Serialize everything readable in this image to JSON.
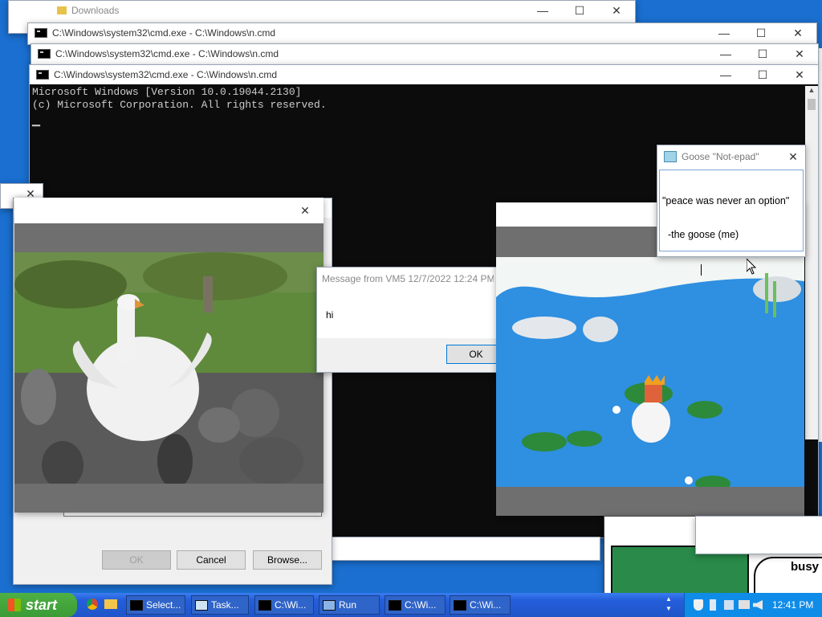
{
  "explorer": {
    "title": "Downloads"
  },
  "cmd": [
    {
      "title": "C:\\Windows\\system32\\cmd.exe - C:\\Windows\\n.cmd"
    },
    {
      "title": "C:\\Windows\\system32\\cmd.exe - C:\\Windows\\n.cmd"
    },
    {
      "title": "C:\\Windows\\system32\\cmd.exe - C:\\Windows\\n.cmd"
    }
  ],
  "console": {
    "line1": "Microsoft Windows [Version 10.0.19044.2130]",
    "line2": "(c) Microsoft Corporation. All rights reserved.",
    "cursor": "▁"
  },
  "notepad": {
    "title": "Goose \"Not-epad\"",
    "line1": "\"peace was never an option\"",
    "line2": "  -the goose (me)"
  },
  "message": {
    "title": "Message from VM5 12/7/2022 12:24 PM",
    "body": "hi",
    "ok": "OK"
  },
  "dialog": {
    "ok": "OK",
    "cancel": "Cancel",
    "browse": "Browse..."
  },
  "busy_text": "busy",
  "icons": {
    "close": "✕",
    "minimize": "—",
    "maximize": "☐"
  },
  "taskbar": {
    "start": "start",
    "items": [
      "Select...",
      "Task...",
      "C:\\Wi...",
      "Run",
      "C:\\Wi...",
      "C:\\Wi..."
    ],
    "time": "12:41 PM"
  },
  "colors": {
    "taskbar": "#245edb",
    "start": "#3c9b35",
    "console": "#0c0c0c",
    "pond": "#2f8fe0"
  }
}
